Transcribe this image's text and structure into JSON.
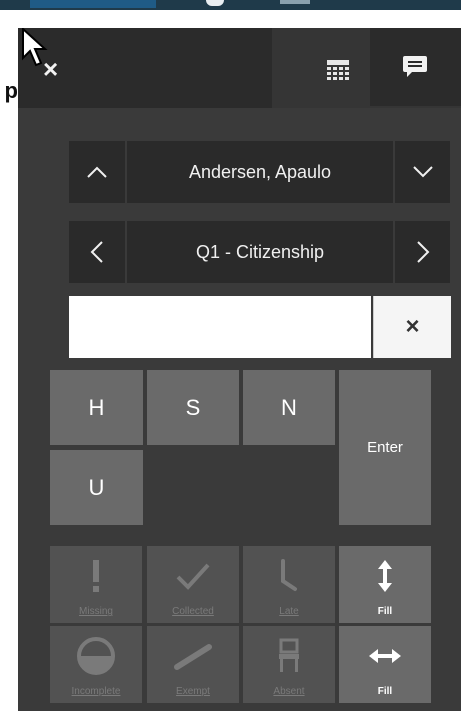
{
  "peek_text": "p",
  "header": {
    "close": "×"
  },
  "student_nav": {
    "name": "Andersen, Apaulo"
  },
  "question_nav": {
    "label": "Q1 - Citizenship"
  },
  "entry": {
    "value": "",
    "clear": "×"
  },
  "keys": {
    "h": "H",
    "s": "S",
    "n": "N",
    "u": "U",
    "enter": "Enter"
  },
  "attendance": {
    "missing": "Missing",
    "collected": "Collected",
    "late": "Late",
    "fill_vertical": "Fill",
    "incomplete": "Incomplete",
    "exempt": "Exempt",
    "absent": "Absent",
    "fill_horizontal": "Fill"
  },
  "colors": {
    "panel": "#3a3a3a",
    "button_dark": "#2a2a2a",
    "key": "#6a6a6a",
    "disabled": "#525252"
  }
}
